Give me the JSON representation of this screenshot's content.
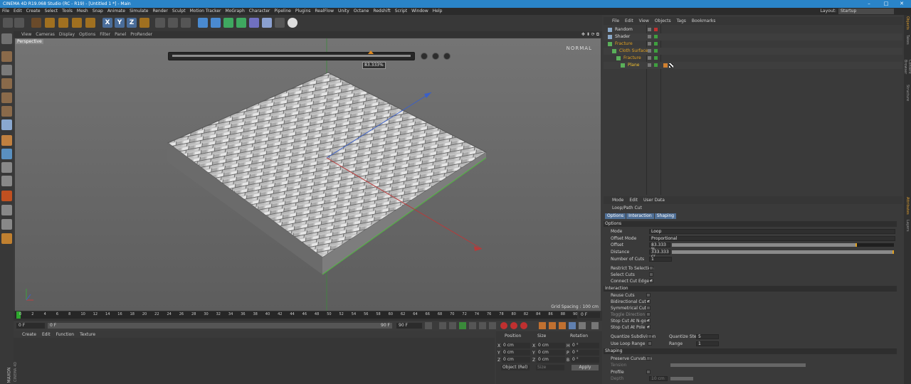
{
  "app": {
    "title": "CINEMA 4D R19.068 Studio (RC - R19) - [Untitled 1 *] - Main",
    "window_controls": [
      "–",
      "□",
      "✕"
    ]
  },
  "menu": [
    "File",
    "Edit",
    "Create",
    "Select",
    "Tools",
    "Mesh",
    "Snap",
    "Animate",
    "Simulate",
    "Render",
    "Sculpt",
    "Motion Tracker",
    "MoGraph",
    "Character",
    "Pipeline",
    "Plugins",
    "RealFlow",
    "Unity",
    "Octane",
    "Redshift",
    "Script",
    "Window",
    "Help"
  ],
  "layout": {
    "label": "Layout:",
    "value": "Startup"
  },
  "toolbar": {
    "axis_labels": [
      "X",
      "Y",
      "Z"
    ]
  },
  "viewport": {
    "menu": [
      "View",
      "Cameras",
      "Display",
      "Options",
      "Filter",
      "Panel",
      "ProRender"
    ],
    "label": "Perspective",
    "mode": "NORMAL",
    "offset_tooltip": "83.333%",
    "offset_fraction": 0.833,
    "grid_spacing": "Grid Spacing : 100 cm"
  },
  "timeline": {
    "ticks": [
      "0",
      "2",
      "4",
      "6",
      "8",
      "10",
      "12",
      "14",
      "16",
      "18",
      "20",
      "22",
      "24",
      "26",
      "28",
      "30",
      "32",
      "34",
      "36",
      "38",
      "40",
      "42",
      "44",
      "46",
      "48",
      "50",
      "52",
      "54",
      "56",
      "58",
      "60",
      "62",
      "64",
      "66",
      "68",
      "70",
      "72",
      "74",
      "76",
      "78",
      "80",
      "82",
      "84",
      "86",
      "88",
      "90"
    ],
    "end_frame": "0 F",
    "start_field": "0 F",
    "min_field": "0 F",
    "max_field": "90 F",
    "range_end": "90 F"
  },
  "material": {
    "menu": [
      "Create",
      "Edit",
      "Function",
      "Texture"
    ],
    "brand": "MAXON",
    "brand_sub": "CINEMA 4D"
  },
  "coords": {
    "headers": [
      "Position",
      "Size",
      "Rotation"
    ],
    "rows": [
      {
        "axis": "X",
        "pos": "0 cm",
        "size_axis": "X",
        "size": "0 cm",
        "rot_axis": "H",
        "rot": "0 °"
      },
      {
        "axis": "Y",
        "pos": "0 cm",
        "size_axis": "Y",
        "size": "0 cm",
        "rot_axis": "P",
        "rot": "0 °"
      },
      {
        "axis": "Z",
        "pos": "0 cm",
        "size_axis": "Z",
        "size": "0 cm",
        "rot_axis": "B",
        "rot": "0 °"
      }
    ],
    "mode": "Object (Rel)",
    "size_mode": "Size",
    "apply": "Apply"
  },
  "objects": {
    "menu": [
      "File",
      "Edit",
      "View",
      "Objects",
      "Tags",
      "Bookmarks"
    ],
    "items": [
      {
        "name": "Random",
        "indent": 0,
        "color": "#d8d8d8"
      },
      {
        "name": "Shader",
        "indent": 0,
        "color": "#d8d8d8"
      },
      {
        "name": "Fracture",
        "indent": 0,
        "color": "#e0a020"
      },
      {
        "name": "Cloth Surface",
        "indent": 1,
        "color": "#e0a020"
      },
      {
        "name": "Fracture",
        "indent": 2,
        "color": "#e0a020"
      },
      {
        "name": "Plane",
        "indent": 3,
        "color": "#f0c030"
      }
    ]
  },
  "attributes": {
    "menu": [
      "Mode",
      "Edit",
      "User Data"
    ],
    "title": "Loop/Path Cut",
    "tabs": [
      "Options",
      "Interaction",
      "Shaping"
    ],
    "sec_options": "Options",
    "mode_label": "Mode",
    "mode_value": "Loop",
    "offset_mode_label": "Offset Mode",
    "offset_mode_value": "Proportional",
    "offset_label": "Offset",
    "offset_value": "83.333 %",
    "offset_fraction": 0.833,
    "distance_label": "Distance",
    "distance_value": "333.333 cr",
    "distance_fraction": 1.0,
    "cuts_label": "Number of Cuts",
    "cuts_value": "1",
    "restrict": "Restrict To Selection",
    "select_cuts": "Select Cuts",
    "connect": "Connect Cut Edges",
    "sec_interaction": "Interaction",
    "reuse": "Reuse Cuts",
    "bidirectional": "Bidirectional Cut",
    "symmetrical": "Symmetrical Cut",
    "toggle_dir": "Toggle Direction",
    "stop_ngon": "Stop Cut At N-gon",
    "stop_pole": "Stop Cut At Pole",
    "quantize_sub": "Quantize Subdivision",
    "quantize_sub_value": "5",
    "quantize_step": "Quantize Step",
    "quantize_step_value": "5",
    "use_loop_range": "Use Loop Range",
    "range_label": "Range",
    "range_value": "1",
    "sec_shaping": "Shaping",
    "preserve": "Preserve Curvature",
    "tension": "Tension",
    "profile": "Profile",
    "depth": "Depth",
    "depth_value": "10 cm"
  },
  "side_tabs": [
    "Objects",
    "Takes",
    "Content Browser",
    "Structure",
    "Attributes",
    "Layers"
  ]
}
